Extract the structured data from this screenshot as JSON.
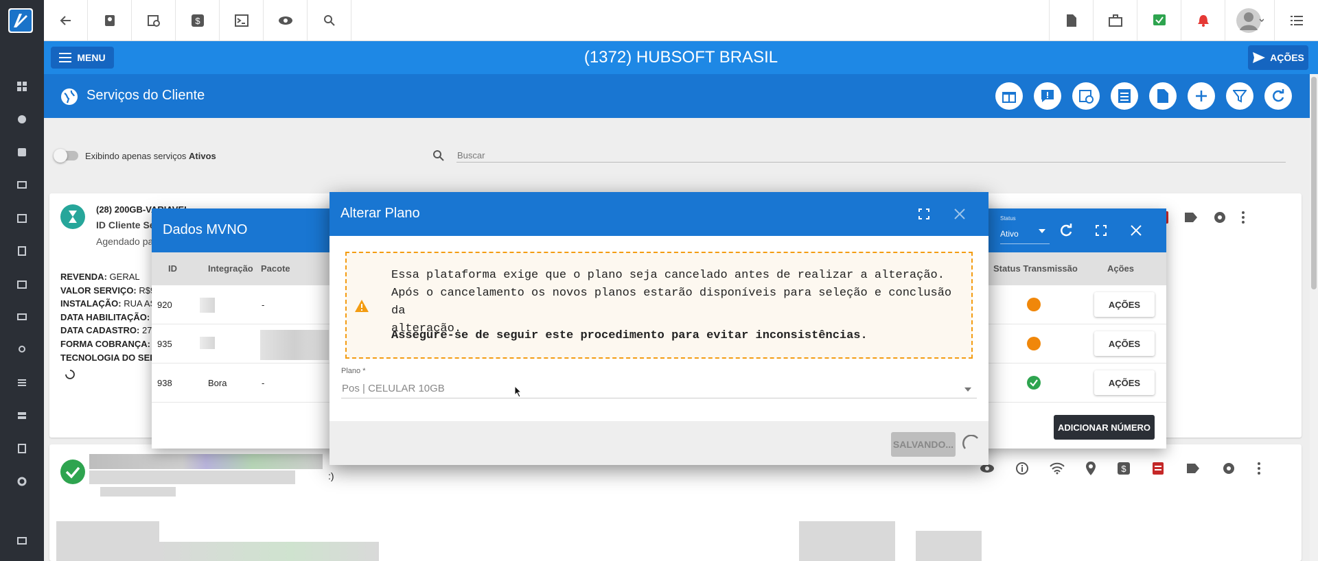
{
  "header": {
    "title": "(1372) HUBSOFT BRASIL",
    "menu_label": "MENU",
    "actions_label": "AÇÕES"
  },
  "subheader": {
    "title": "Serviços do Cliente"
  },
  "filters": {
    "toggle_label_prefix": "Exibindo apenas serviços ",
    "toggle_label_bold": "Ativos",
    "search_placeholder": "Buscar"
  },
  "service_card": {
    "title": "(28) 200GB-VARIAVEL",
    "subtitle": "ID Cliente Se",
    "scheduled": "Agendado pa",
    "details": [
      {
        "label": "REVENDA:",
        "value": "GERAL"
      },
      {
        "label": "VALOR SERVIÇO:",
        "value": "R$9"
      },
      {
        "label": "INSTALAÇÃO:",
        "value": "RUA AS"
      },
      {
        "label": "DATA HABILITAÇÃO:",
        "value": ""
      },
      {
        "label": "DATA CADASTRO:",
        "value": "27"
      },
      {
        "label": "FORMA COBRANÇA:",
        "value": ""
      },
      {
        "label": "TECNOLOGIA DO SER",
        "value": ""
      }
    ]
  },
  "second_card": {
    "fragment": ":)"
  },
  "mvno_modal": {
    "title": "Dados MVNO",
    "status_label": "Status",
    "status_value": "Ativo",
    "columns": {
      "id": "ID",
      "integracao": "Integração",
      "pacote": "Pacote",
      "status_transmissao": "Status Transmissão",
      "acoes": "Ações"
    },
    "rows": [
      {
        "id": "920",
        "integracao": "",
        "pacote": "-",
        "status_color": "#f0870a",
        "acoes": "AÇÕES"
      },
      {
        "id": "935",
        "integracao": "",
        "pacote": "",
        "status_color": "#f0870a",
        "acoes": "AÇÕES"
      },
      {
        "id": "938",
        "integracao": "Bora",
        "pacote": "-",
        "status_color": "#2ea44f",
        "acoes": "AÇÕES"
      }
    ],
    "add_number_label": "ADICIONAR NÚMERO"
  },
  "alterar_plano_modal": {
    "title": "Alterar Plano",
    "warning_lines": [
      "Essa plataforma exige que o plano seja cancelado antes de realizar a alteração.",
      "Após o cancelamento os novos planos estarão disponíveis para seleção e conclusão da",
      "alteração."
    ],
    "warning_bold": "Assegure-se de seguir este procedimento para evitar inconsistências.",
    "plano_label": "Plano *",
    "plano_value": "Pos | CELULAR 10GB",
    "save_label": "SALVANDO..."
  },
  "colors": {
    "primary": "#1976d2",
    "header": "#1e88e5",
    "sidebar": "#2b2f36",
    "warning": "#f39c12"
  }
}
